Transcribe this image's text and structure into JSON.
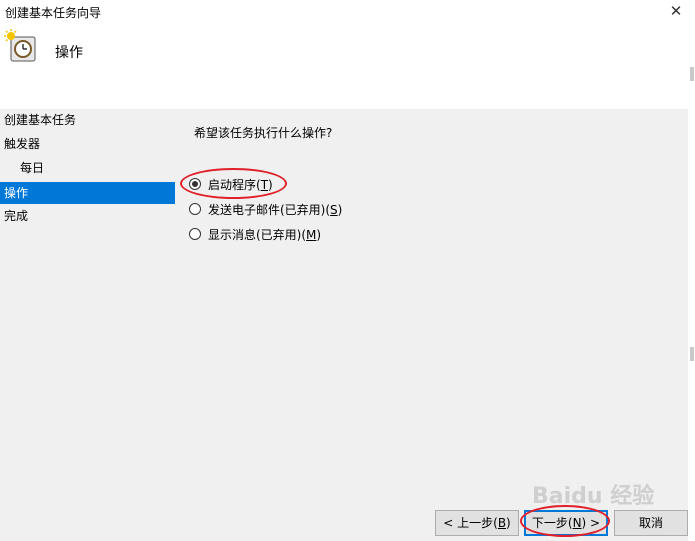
{
  "window": {
    "title": "创建基本任务向导",
    "close_glyph": "✕"
  },
  "header": {
    "title": "操作"
  },
  "sidebar": {
    "items": [
      {
        "label": "创建基本任务"
      },
      {
        "label": "触发器"
      },
      {
        "label": "每日"
      },
      {
        "label": "操作"
      },
      {
        "label": "完成"
      }
    ]
  },
  "main": {
    "question": "希望该任务执行什么操作?",
    "options": [
      {
        "label_pre": "启动程序(",
        "mnemonic": "T",
        "label_post": ")",
        "checked": true
      },
      {
        "label_pre": "发送电子邮件(已弃用)(",
        "mnemonic": "S",
        "label_post": ")",
        "checked": false
      },
      {
        "label_pre": "显示消息(已弃用)(",
        "mnemonic": "M",
        "label_post": ")",
        "checked": false
      }
    ]
  },
  "footer": {
    "back": {
      "pre": "< 上一步(",
      "mnemonic": "B",
      "post": ")"
    },
    "next": {
      "pre": "下一步(",
      "mnemonic": "N",
      "post": ") >"
    },
    "cancel": "取消"
  },
  "watermark": "Baidu 经验",
  "colors": {
    "accent": "#0078d7",
    "annotation": "#e0202a"
  }
}
